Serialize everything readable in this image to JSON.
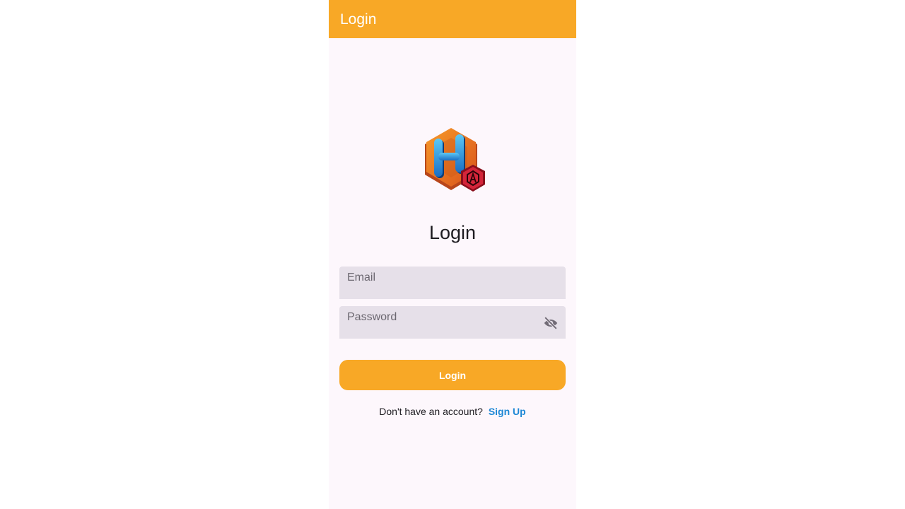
{
  "appbar": {
    "title": "Login",
    "color": "#f8a826"
  },
  "logo": {
    "icon": "hexagon-h-logo-icon"
  },
  "page": {
    "title": "Login",
    "background": "#fdf7fc"
  },
  "form": {
    "email": {
      "placeholder": "Email",
      "value": ""
    },
    "password": {
      "placeholder": "Password",
      "value": "",
      "toggle_icon": "visibility-off-icon"
    },
    "login_label": "Login"
  },
  "signup": {
    "prompt": "Don't have an account?",
    "link_label": "Sign Up",
    "link_color": "#1e88d5"
  }
}
